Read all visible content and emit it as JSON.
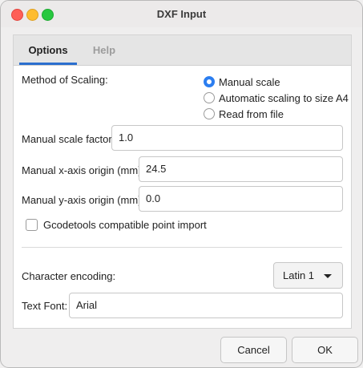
{
  "window": {
    "title": "DXF Input"
  },
  "tabs": [
    {
      "label": "Options",
      "active": true
    },
    {
      "label": "Help",
      "active": false
    }
  ],
  "scaling": {
    "label": "Method of Scaling:",
    "options": [
      {
        "label": "Manual scale",
        "selected": true
      },
      {
        "label": "Automatic scaling to size A4",
        "selected": false
      },
      {
        "label": "Read from file",
        "selected": false
      }
    ]
  },
  "fields": {
    "scale_factor": {
      "label": "Manual scale factor:",
      "value": "1.0"
    },
    "x_origin": {
      "label": "Manual x-axis origin (mm):",
      "value": "24.5"
    },
    "y_origin": {
      "label": "Manual y-axis origin (mm):",
      "value": "0.0"
    }
  },
  "gcodetools": {
    "label": "Gcodetools compatible point import",
    "checked": false
  },
  "encoding": {
    "label": "Character encoding:",
    "value": "Latin 1"
  },
  "font": {
    "label": "Text Font:",
    "value": "Arial"
  },
  "buttons": {
    "cancel": "Cancel",
    "ok": "OK"
  },
  "colors": {
    "accent": "#2c7ef0",
    "tab_underline": "#2b6fce"
  }
}
